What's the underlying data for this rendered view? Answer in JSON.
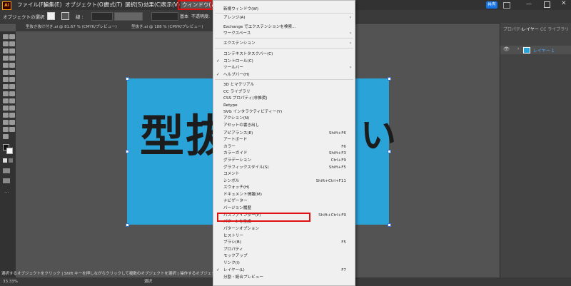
{
  "menubar": {
    "logo": "Ai",
    "items": [
      "ファイル(F)",
      "編集(E)",
      "オブジェクト(O)",
      "書式(T)",
      "選択(S)",
      "効果(C)",
      "表示(V)",
      "ウィンドウ(W)"
    ],
    "share": "共有"
  },
  "controlbar": {
    "label": "オブジェクトの選択",
    "stroke_label": "線 :",
    "basic": "基本",
    "opacity": "不透明度:"
  },
  "tabs": [
    "型抜き抜け付き.ai @ 81.67 % (CMYK/プレビュー)",
    "型抜き.ai @ 188 % (CMYK/プレビュー)"
  ],
  "canvas": {
    "big_text": "型抜",
    "big_text_tail": "い"
  },
  "status": {
    "zoom": "33.33%",
    "tool": "選択",
    "hint": "選択するオブジェクトをクリック | Shift キーを押しながらクリックして複数のオブジェクトを選択 | 操作するオブジェクト..."
  },
  "rightpanel": {
    "tabs": [
      "プロパティ",
      "レイヤー",
      "CC ライブラリ"
    ],
    "layer_name": "レイヤー 1"
  },
  "window_menu": [
    {
      "label": "新規ウィンドウ(W)",
      "sep_after": true
    },
    {
      "label": "アレンジ(A)",
      "arrow": true
    },
    {
      "label": "Exchange でエクステンションを検索...",
      "arrow": false
    },
    {
      "label": "ワークスペース",
      "arrow": true,
      "sep_after": true
    },
    {
      "label": "エクステンション",
      "arrow": true,
      "sep_after": true
    },
    {
      "label": "コンテキストタスクバー(C)"
    },
    {
      "label": "コントロール(C)",
      "check": true
    },
    {
      "label": "ツールバー",
      "arrow": true
    },
    {
      "label": "ヘルプバー(H)",
      "check": true,
      "sep_after": true
    },
    {
      "label": "3D とマテリアル"
    },
    {
      "label": "CC ライブラリ"
    },
    {
      "label": "CSS プロパティ(非推奨)"
    },
    {
      "label": "Retype"
    },
    {
      "label": "SVG インタラクティビティー(Y)"
    },
    {
      "label": "アクション(N)"
    },
    {
      "label": "アセットの書き出し"
    },
    {
      "label": "アピアランス(E)",
      "shortcut": "Shift+F6"
    },
    {
      "label": "アートボード"
    },
    {
      "label": "カラー",
      "shortcut": "F6"
    },
    {
      "label": "カラーガイド",
      "shortcut": "Shift+F3"
    },
    {
      "label": "グラデーション",
      "shortcut": "Ctrl+F9"
    },
    {
      "label": "グラフィックスタイル(S)",
      "shortcut": "Shift+F5"
    },
    {
      "label": "コメント"
    },
    {
      "label": "シンボル",
      "shortcut": "Shift+Ctrl+F11"
    },
    {
      "label": "スウォッチ(H)"
    },
    {
      "label": "ドキュメント情報(M)"
    },
    {
      "label": "ナビゲーター"
    },
    {
      "label": "バージョン履歴"
    },
    {
      "label": "パスファインダー(P)",
      "shortcut": "Shift+Ctrl+F9",
      "highlight": true
    },
    {
      "label": "パターンを生成"
    },
    {
      "label": "パターンオプション"
    },
    {
      "label": "ヒストリー"
    },
    {
      "label": "ブラシ(B)",
      "shortcut": "F5"
    },
    {
      "label": "プロパティ"
    },
    {
      "label": "モックアップ"
    },
    {
      "label": "リンク(I)"
    },
    {
      "label": "レイヤー(L)",
      "shortcut": "F7",
      "check": true
    },
    {
      "label": "分割・統合プレビュー"
    }
  ],
  "colors": {
    "artboard": "#2aa3d9",
    "highlight": "#e01010",
    "share_button": "#1473e6"
  }
}
